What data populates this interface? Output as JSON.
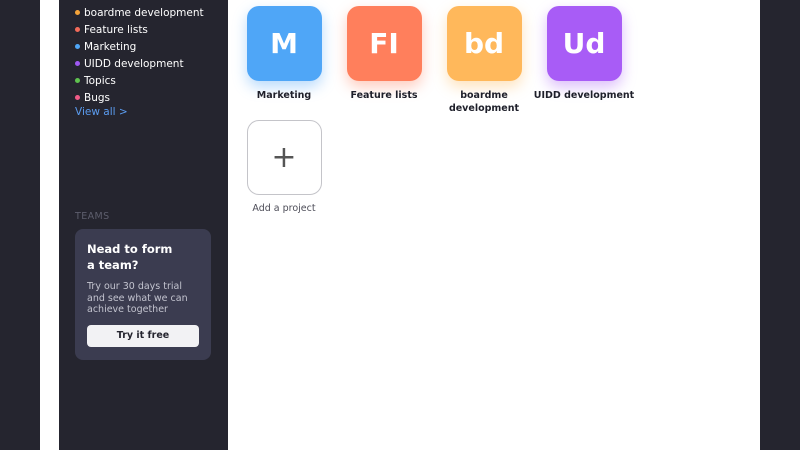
{
  "sidebar": {
    "projects": [
      {
        "label": "boardme development",
        "color": "#f5a43a"
      },
      {
        "label": "Feature lists",
        "color": "#f36b5a"
      },
      {
        "label": "Marketing",
        "color": "#4fa6f7"
      },
      {
        "label": "UIDD development",
        "color": "#9f59f2"
      },
      {
        "label": "Topics",
        "color": "#5fc24f"
      },
      {
        "label": "Bugs",
        "color": "#f15b87"
      }
    ],
    "view_all": "View all >",
    "teams_heading": "TEAMS",
    "team_card": {
      "title": "Nead to form a team?",
      "text": "Try our 30 days trial and see what we can achieve together",
      "button": "Try it free"
    }
  },
  "main": {
    "tiles": [
      {
        "initials": "M",
        "label": "Marketing",
        "color": "#4fa6f7"
      },
      {
        "initials": "FI",
        "label": "Feature lists",
        "color": "#ff7f5c"
      },
      {
        "initials": "bd",
        "label": "boardme development",
        "color": "#ffb85b"
      },
      {
        "initials": "Ud",
        "label": "UIDD development",
        "color": "#a85cf6"
      }
    ],
    "add_project": {
      "icon": "plus-icon",
      "glyph": "+",
      "label": "Add a project"
    }
  }
}
